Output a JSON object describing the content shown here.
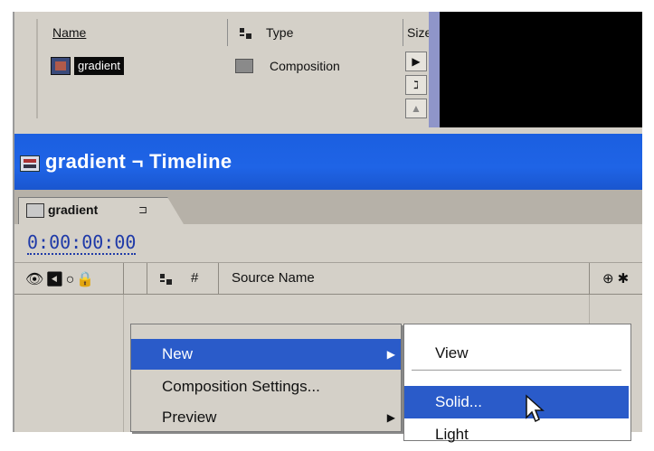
{
  "project": {
    "headers": {
      "name": "Name",
      "type": "Type",
      "size": "Size"
    },
    "item": {
      "name": "gradient",
      "type": "Composition"
    },
    "buttons": {
      "play": "▶",
      "flow": "ℷ",
      "scroll": "▲"
    }
  },
  "timeline": {
    "title": "gradient ¬ Timeline",
    "tab_label": "gradient",
    "tab_menu": "⊐",
    "timecode": "0:00:00:00",
    "columns": {
      "av": "👁◀○🔒",
      "hash": "#",
      "source": "Source Name",
      "switches": "⊕✱"
    }
  },
  "context_menu": {
    "items": [
      {
        "label": "New",
        "has_submenu": true,
        "active": true
      },
      {
        "label": "Composition Settings...",
        "has_submenu": false,
        "active": false
      },
      {
        "label": "Preview",
        "has_submenu": true,
        "active": false
      }
    ],
    "submenu_arrow": "▶"
  },
  "submenu": {
    "items": [
      {
        "label": "View",
        "active": false
      },
      {
        "label": "Solid...",
        "active": true
      },
      {
        "label": "Light",
        "active": false
      }
    ]
  },
  "colors": {
    "title_bar": "#1f64e6",
    "menu_highlight": "#2a5bc9",
    "timecode": "#1f3aa8",
    "panel_bg": "#d4d0c8"
  }
}
